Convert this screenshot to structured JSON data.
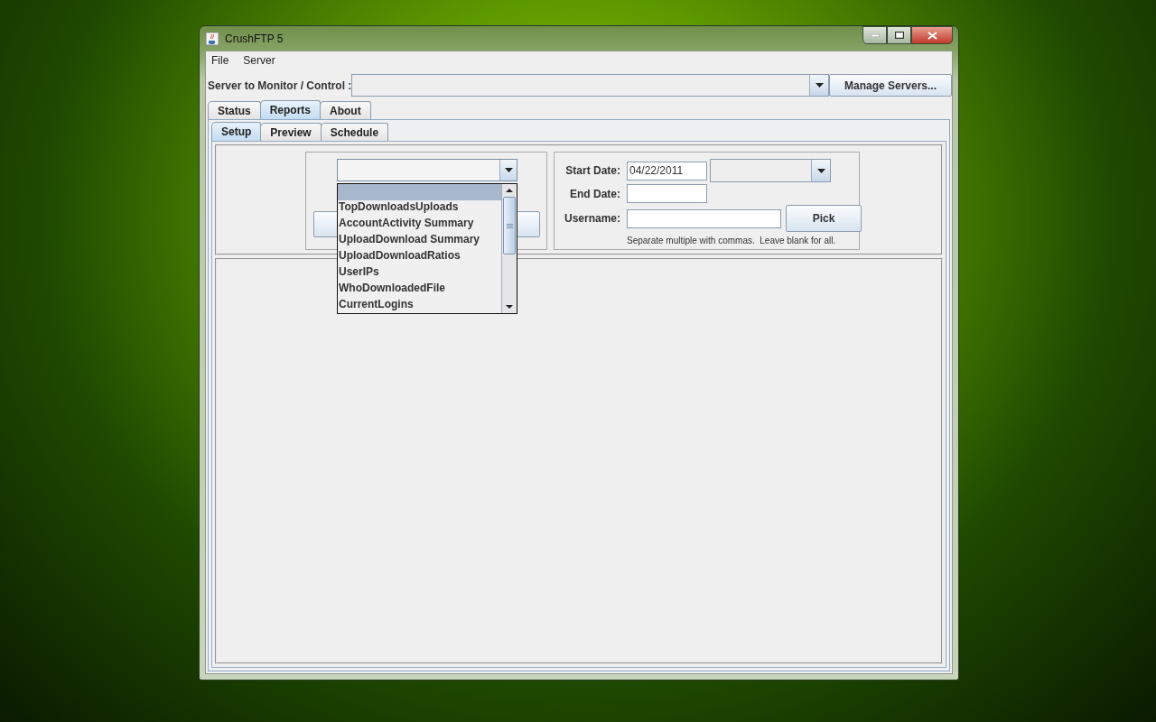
{
  "window": {
    "title": "CrushFTP 5"
  },
  "menu": [
    "File",
    "Server"
  ],
  "server_selector": {
    "label": "Server to Monitor / Control :",
    "button": "Manage Servers..."
  },
  "tabs": [
    {
      "label": "Status",
      "selected": false
    },
    {
      "label": "Reports",
      "selected": true
    },
    {
      "label": "About",
      "selected": false
    }
  ],
  "subtabs": [
    {
      "label": "Setup",
      "selected": true
    },
    {
      "label": "Preview",
      "selected": false
    },
    {
      "label": "Schedule",
      "selected": false
    }
  ],
  "report_dropdown": {
    "expanded": true,
    "blank_option": {
      "selected": true
    },
    "options": [
      {
        "label": "TopDownloadsUploads",
        "selected": false
      },
      {
        "label": "AccountActivity Summary",
        "selected": false
      },
      {
        "label": "UploadDownload Summary",
        "selected": false
      },
      {
        "label": "UploadDownloadRatios",
        "selected": false
      },
      {
        "label": "UserIPs",
        "selected": false
      },
      {
        "label": "WhoDownloadedFile",
        "selected": false
      },
      {
        "label": "CurrentLogins",
        "selected": false
      }
    ]
  },
  "filters": {
    "start_date_label": "Start Date:",
    "start_date": "04/22/2011",
    "end_date_label": "End Date:",
    "username_label": "Username:",
    "pick_button": "Pick",
    "hint": "Separate multiple with commas.  Leave blank for all."
  }
}
